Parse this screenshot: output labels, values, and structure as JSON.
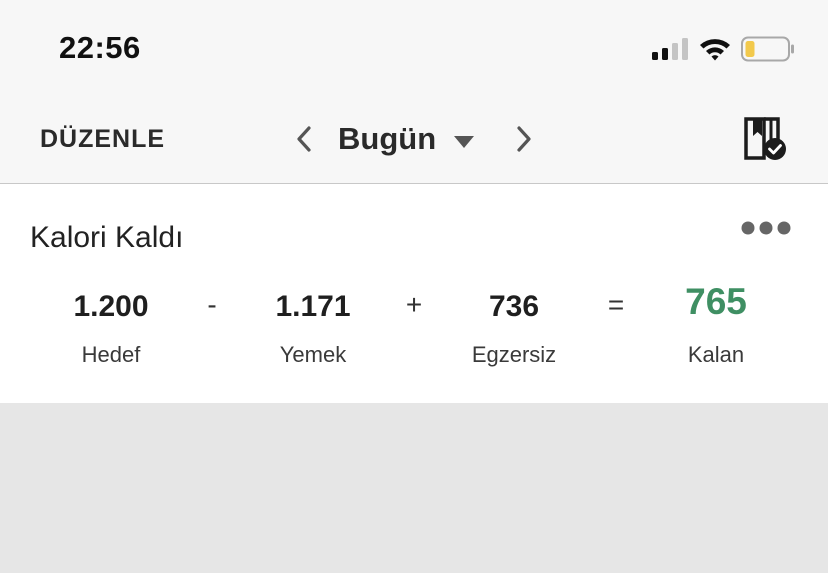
{
  "status_bar": {
    "time": "22:56",
    "icons": [
      "signal-icon",
      "wifi-icon",
      "battery-icon"
    ],
    "battery_color": "#f2c94c"
  },
  "nav": {
    "edit_label": "DÜZENLE",
    "date_label": "Bugün",
    "icons": [
      "chevron-left-icon",
      "caret-down-icon",
      "chevron-right-icon",
      "day-complete-icon"
    ]
  },
  "card": {
    "title": "Kalori Kaldı",
    "more_icon": "more-dots-icon",
    "stats": [
      {
        "value": "1.200",
        "label": "Hedef"
      },
      {
        "value": "1.171",
        "label": "Yemek"
      },
      {
        "value": "736",
        "label": "Egzersiz"
      },
      {
        "value": "765",
        "label": "Kalan"
      }
    ],
    "operators": [
      "-",
      "+",
      "="
    ],
    "accent_color": "#3f8f63"
  }
}
